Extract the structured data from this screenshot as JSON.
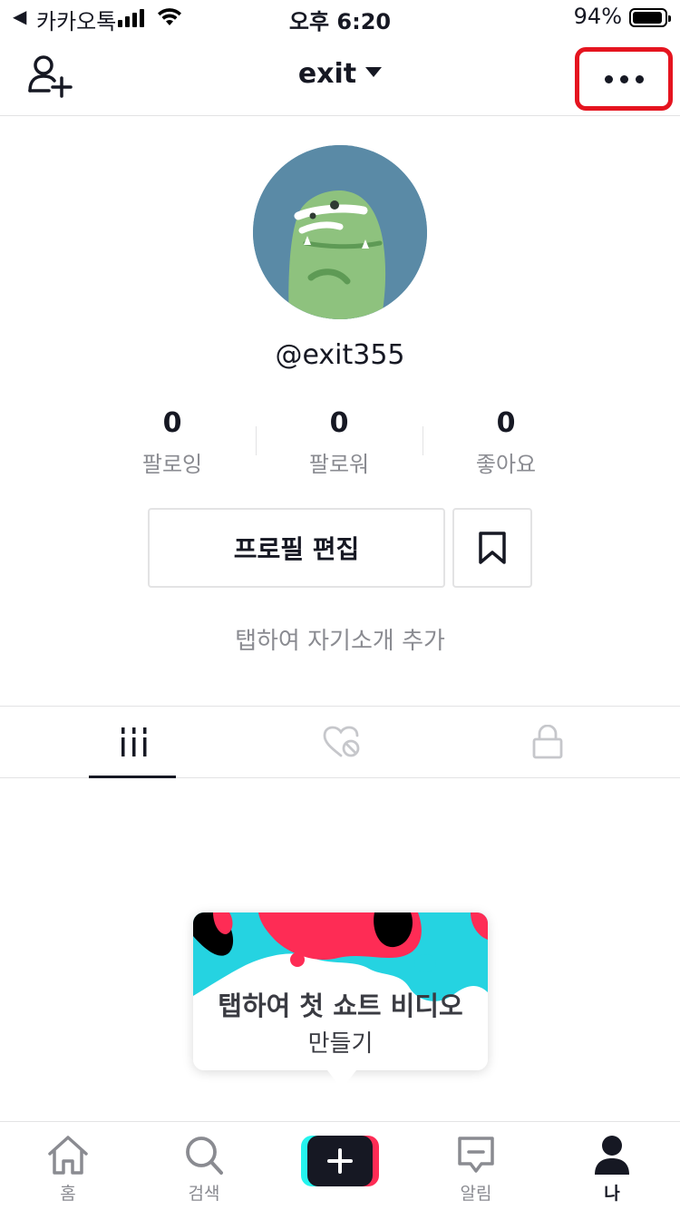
{
  "status_bar": {
    "back_icon": "◀",
    "carrier": "카카오톡",
    "time": "오후 6:20",
    "battery_pct": "94%",
    "battery_level": 0.94
  },
  "header": {
    "account_name": "exit",
    "add_user_icon": "add-user-icon",
    "more_icon": "more-horizontal-icon",
    "highlight_color": "#e5141f"
  },
  "profile": {
    "username": "@exit355",
    "stats": [
      {
        "value": "0",
        "label": "팔로잉"
      },
      {
        "value": "0",
        "label": "팔로워"
      },
      {
        "value": "0",
        "label": "좋아요"
      }
    ],
    "edit_button": "프로필 편집",
    "bio_placeholder": "탭하여 자기소개 추가"
  },
  "tabs": [
    {
      "icon": "grid-videos-icon",
      "active": true
    },
    {
      "icon": "liked-hidden-icon",
      "active": false
    },
    {
      "icon": "lock-icon",
      "active": false
    }
  ],
  "create_card": {
    "title": "탭하여 첫 쇼트 비디오",
    "subtitle": "만들기"
  },
  "bottom_nav": [
    {
      "label": "홈",
      "icon": "home-icon"
    },
    {
      "label": "검색",
      "icon": "search-icon"
    },
    {
      "label": "",
      "icon": "plus-icon"
    },
    {
      "label": "알림",
      "icon": "inbox-icon"
    },
    {
      "label": "나",
      "icon": "profile-icon"
    }
  ],
  "colors": {
    "accent_red": "#fe2c55",
    "accent_cyan": "#25f4ee",
    "text_primary": "#161823",
    "text_secondary": "#8a8b91"
  }
}
